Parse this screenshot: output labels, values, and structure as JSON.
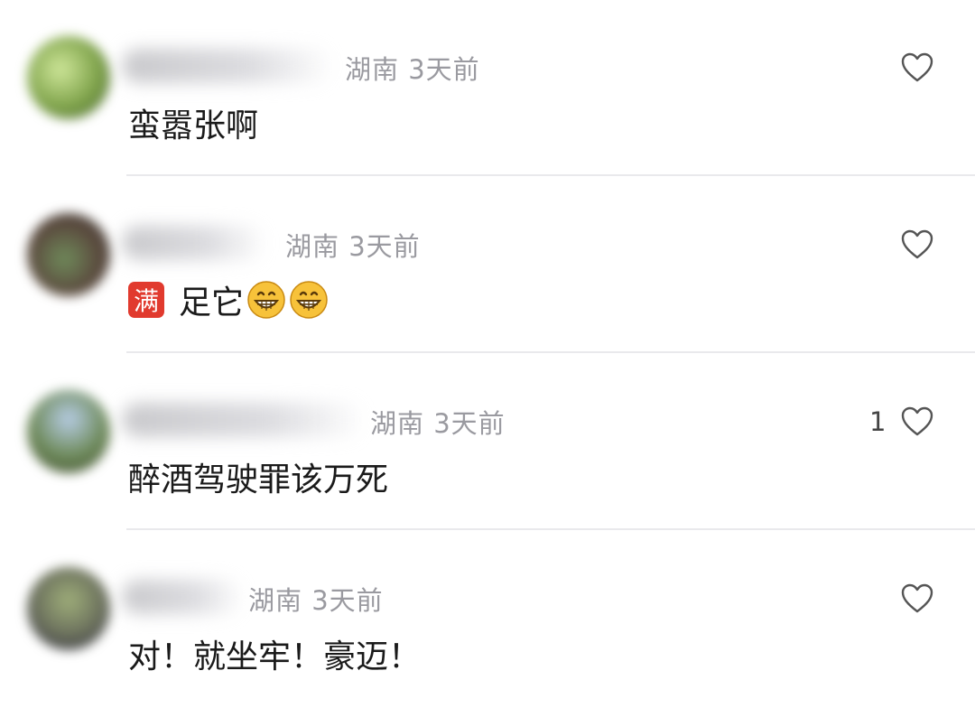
{
  "comments": [
    {
      "location": "湖南",
      "time": "3天前",
      "text": "蛮嚣张啊",
      "likes": ""
    },
    {
      "location": "湖南",
      "time": "3天前",
      "badge": "满",
      "text": "足它",
      "likes": ""
    },
    {
      "location": "湖南",
      "time": "3天前",
      "text": "醉酒驾驶罪该万死",
      "likes": "1"
    },
    {
      "location": "湖南",
      "time": "3天前",
      "text": "对！就坐牢！豪迈！",
      "likes": ""
    }
  ],
  "icons": {
    "like": "heart-outline-icon",
    "emoji": "grinning-face-emoji"
  },
  "colors": {
    "meta": "#9a9aa0",
    "text": "#1a1a1a",
    "badge": "#e13a2e",
    "divider": "#e9e9ec"
  }
}
